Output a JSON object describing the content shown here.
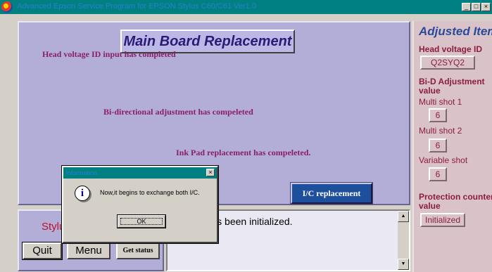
{
  "window": {
    "title": "Advanced Epson Service Program for EPSON Stylus C60/C61 Ver1.0",
    "minimize": "_",
    "maximize": "□",
    "close": "×"
  },
  "main": {
    "title": "Main Board Replacement",
    "messages": [
      "Head voltage ID input has completed",
      "Bi-directional adjustment has compeleted",
      "Ink Pad replacement has compeleted."
    ],
    "ic_button": "I/C replacement"
  },
  "bottom": {
    "stylus_label": "Stylus",
    "quit": "Quit",
    "menu": "Menu",
    "get_status": "Get status",
    "log_text": "counter has been initialized."
  },
  "adjusted_items": {
    "title": "Adjusted Item",
    "head_voltage_label": "Head voltage ID",
    "head_voltage_value": "Q2SYQ2",
    "bid_label_1": "Bi-D Adjustment",
    "bid_label_2": "value",
    "multi_shot_1_label": "Multi shot 1",
    "multi_shot_1_value": "6",
    "multi_shot_2_label": "Multi shot 2",
    "multi_shot_2_value": "6",
    "variable_shot_label": "Variable shot",
    "variable_shot_value": "6",
    "protection_label_1": "Protection counter",
    "protection_label_2": "value",
    "protection_value": "Initialized"
  },
  "dialog": {
    "title": "Information",
    "close": "×",
    "icon": "i",
    "message": "Now,it begins to exchange both I/C.",
    "ok": "OK"
  },
  "colors": {
    "titlebar": "#008080",
    "panel": "#b2aed8",
    "message_text": "#8a1e6a",
    "ic_button": "#1e4f9c",
    "sidebar": "#d9c2c8"
  }
}
